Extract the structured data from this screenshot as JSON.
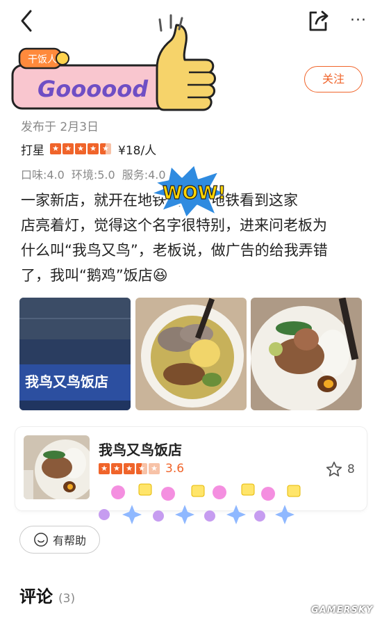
{
  "topbar": {
    "back_icon": "back-chevron-icon",
    "share_icon": "share-icon",
    "more_label": "···"
  },
  "sticker": {
    "tag": "干饭人",
    "text": "Goooood",
    "icon": "thumbs-up-icon"
  },
  "follow_label": "关注",
  "post": {
    "date": "发布于 2月3日",
    "rating_label": "打星",
    "price": "¥18/人",
    "scores": [
      "口味:4.0",
      "环境:5.0",
      "服务:4.0"
    ],
    "review_lines": [
      "一家新店，就开在地铁站，搭地铁看到这家",
      "店亮着灯，觉得这个名字很特别，进来问老板为",
      "什么叫“我鸟又鸟”，老板说，做广告的给我弄错",
      "了，我叫“鹅鸡”饭店😆"
    ],
    "sticker_wow": "WOW!"
  },
  "photos": {
    "sign_text": "我鸟又鸟饭店"
  },
  "shop": {
    "name": "我鸟又鸟饭店",
    "score": "3.6",
    "fav_count": "8"
  },
  "helpful_label": "有帮助",
  "comments": {
    "title": "评论",
    "count": "(3)"
  },
  "watermark": "GAMERSKY",
  "colors": {
    "accent": "#f0642a",
    "accent_light": "#f7c2a7"
  }
}
